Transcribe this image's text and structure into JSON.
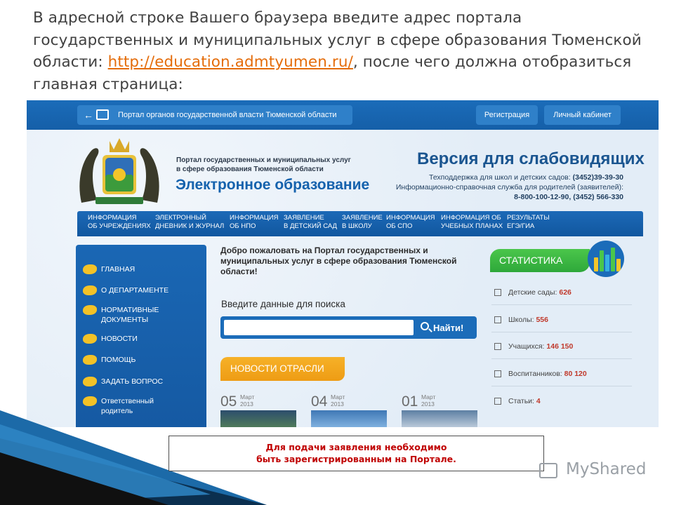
{
  "slide": {
    "title_before": "В адресной строке Вашего браузера введите адрес портала государственных и муниципальных услуг в сфере образования Тюменской области: ",
    "title_link": "http://education.admtyumen.ru/",
    "title_after": ", после чего должна отобразиться главная страница:"
  },
  "portal": {
    "top_link": "Портал органов государственной власти Тюменской области",
    "register_button": "Регистрация",
    "cabinet_button": "Личный кабинет",
    "logo_line1": "Портал государственных и муниципальных услуг",
    "logo_line2": "в сфере образования Тюменской области",
    "logo_main": "Электронное образование",
    "vision_link": "Версия для слабовидящих",
    "support_line1_label": "Техподдержка для школ и детских садов: ",
    "support_line1_phone": "(3452)39-39-30",
    "support_line2": "Информационно-справочная служба для родителей (заявителей):",
    "support_line3": "8-800-100-12-90, (3452) 566-330",
    "menu": [
      {
        "line1": "Информация",
        "line2": "об учреждениях"
      },
      {
        "line1": "Электронный",
        "line2": "дневник и журнал"
      },
      {
        "line1": "Информация",
        "line2": "об НПО"
      },
      {
        "line1": "Заявление",
        "line2": "в детский сад"
      },
      {
        "line1": "Заявление",
        "line2": "в школу"
      },
      {
        "line1": "Информация",
        "line2": "об СПО"
      },
      {
        "line1": "Информация об",
        "line2": "учебных планах"
      },
      {
        "line1": "Результаты",
        "line2": "ЕГЭ/ГИА"
      }
    ],
    "sidebar": [
      {
        "line1": "ГЛАВНАЯ",
        "line2": ""
      },
      {
        "line1": "О ДЕПАРТАМЕНТЕ",
        "line2": ""
      },
      {
        "line1": "НОРМАТИВНЫЕ",
        "line2": "ДОКУМЕНТЫ"
      },
      {
        "line1": "НОВОСТИ",
        "line2": ""
      },
      {
        "line1": "ПОМОЩЬ",
        "line2": ""
      },
      {
        "line1": "ЗАДАТЬ ВОПРОС",
        "line2": ""
      },
      {
        "line1": "Ответственный",
        "line2": "родитель"
      }
    ],
    "welcome": "Добро пожаловать на Портал государственных и муниципальных услуг в сфере образования Тюменской области!",
    "search_label": "Введите данные для поиска",
    "search_value": "",
    "search_button": "Найти!",
    "news_header": "НОВОСТИ ОТРАСЛИ",
    "news": [
      {
        "day": "05",
        "month": "Март",
        "year": "2013"
      },
      {
        "day": "04",
        "month": "Март",
        "year": "2013"
      },
      {
        "day": "01",
        "month": "Март",
        "year": "2013"
      }
    ],
    "stats_header": "СТАТИСТИКА",
    "stats": [
      {
        "label": "Детские сады: ",
        "value": "626"
      },
      {
        "label": "Школы: ",
        "value": "556"
      },
      {
        "label": "Учащихся: ",
        "value": "146 150"
      },
      {
        "label": "Воспитанников: ",
        "value": "80 120"
      },
      {
        "label": "Статьи: ",
        "value": "4"
      }
    ]
  },
  "callout": {
    "line1": "Для подачи заявления необходимо",
    "line2": "быть зарегистрированным на Портале."
  },
  "watermark": "MyShared",
  "colors": {
    "portal_blue": "#1b6cb9",
    "link_orange": "#e46c0a",
    "callout_red": "#c00000",
    "stats_green": "#3cb543",
    "news_orange": "#f2a51c"
  }
}
